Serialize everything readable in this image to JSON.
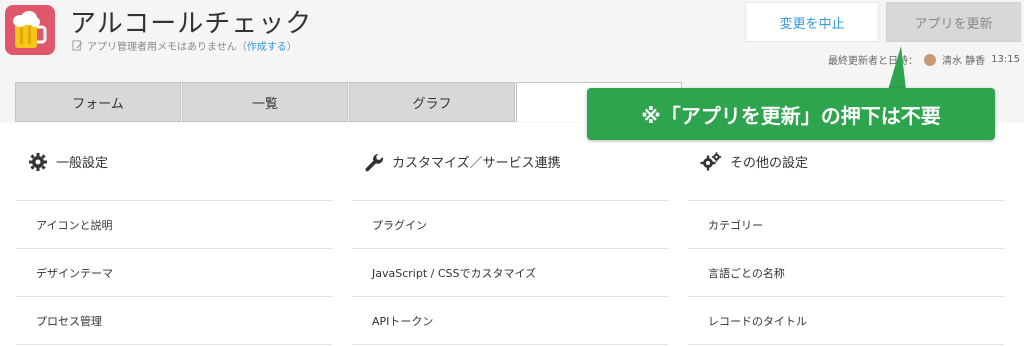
{
  "app": {
    "title": "アルコールチェック",
    "memo_text": "アプリ管理者用メモはありません（",
    "memo_link": "作成する",
    "memo_end": "）"
  },
  "actions": {
    "cancel_label": "変更を中止",
    "update_label": "アプリを更新"
  },
  "updated": {
    "label": "最終更新者と日時：",
    "user": "清水 静香",
    "time": "13:15"
  },
  "tabs": [
    {
      "label": "フォーム"
    },
    {
      "label": "一覧"
    },
    {
      "label": "グラフ"
    },
    {
      "label": ""
    }
  ],
  "sections": [
    {
      "title": "一般設定",
      "icon": "gear-icon",
      "items": [
        "アイコンと説明",
        "デザインテーマ",
        "プロセス管理"
      ]
    },
    {
      "title": "カスタマイズ／サービス連携",
      "icon": "wrench-icon",
      "items": [
        "プラグイン",
        "JavaScript / CSSでカスタマイズ",
        "APIトークン"
      ]
    },
    {
      "title": "その他の設定",
      "icon": "gears-icon",
      "items": [
        "カテゴリー",
        "言語ごとの名称",
        "レコードのタイトル"
      ]
    }
  ],
  "callout": {
    "text": "※「アプリを更新」の押下は不要"
  },
  "colors": {
    "accent_blue": "#3498db",
    "callout_green": "#2ea44f",
    "app_icon_red": "#e0566a"
  }
}
